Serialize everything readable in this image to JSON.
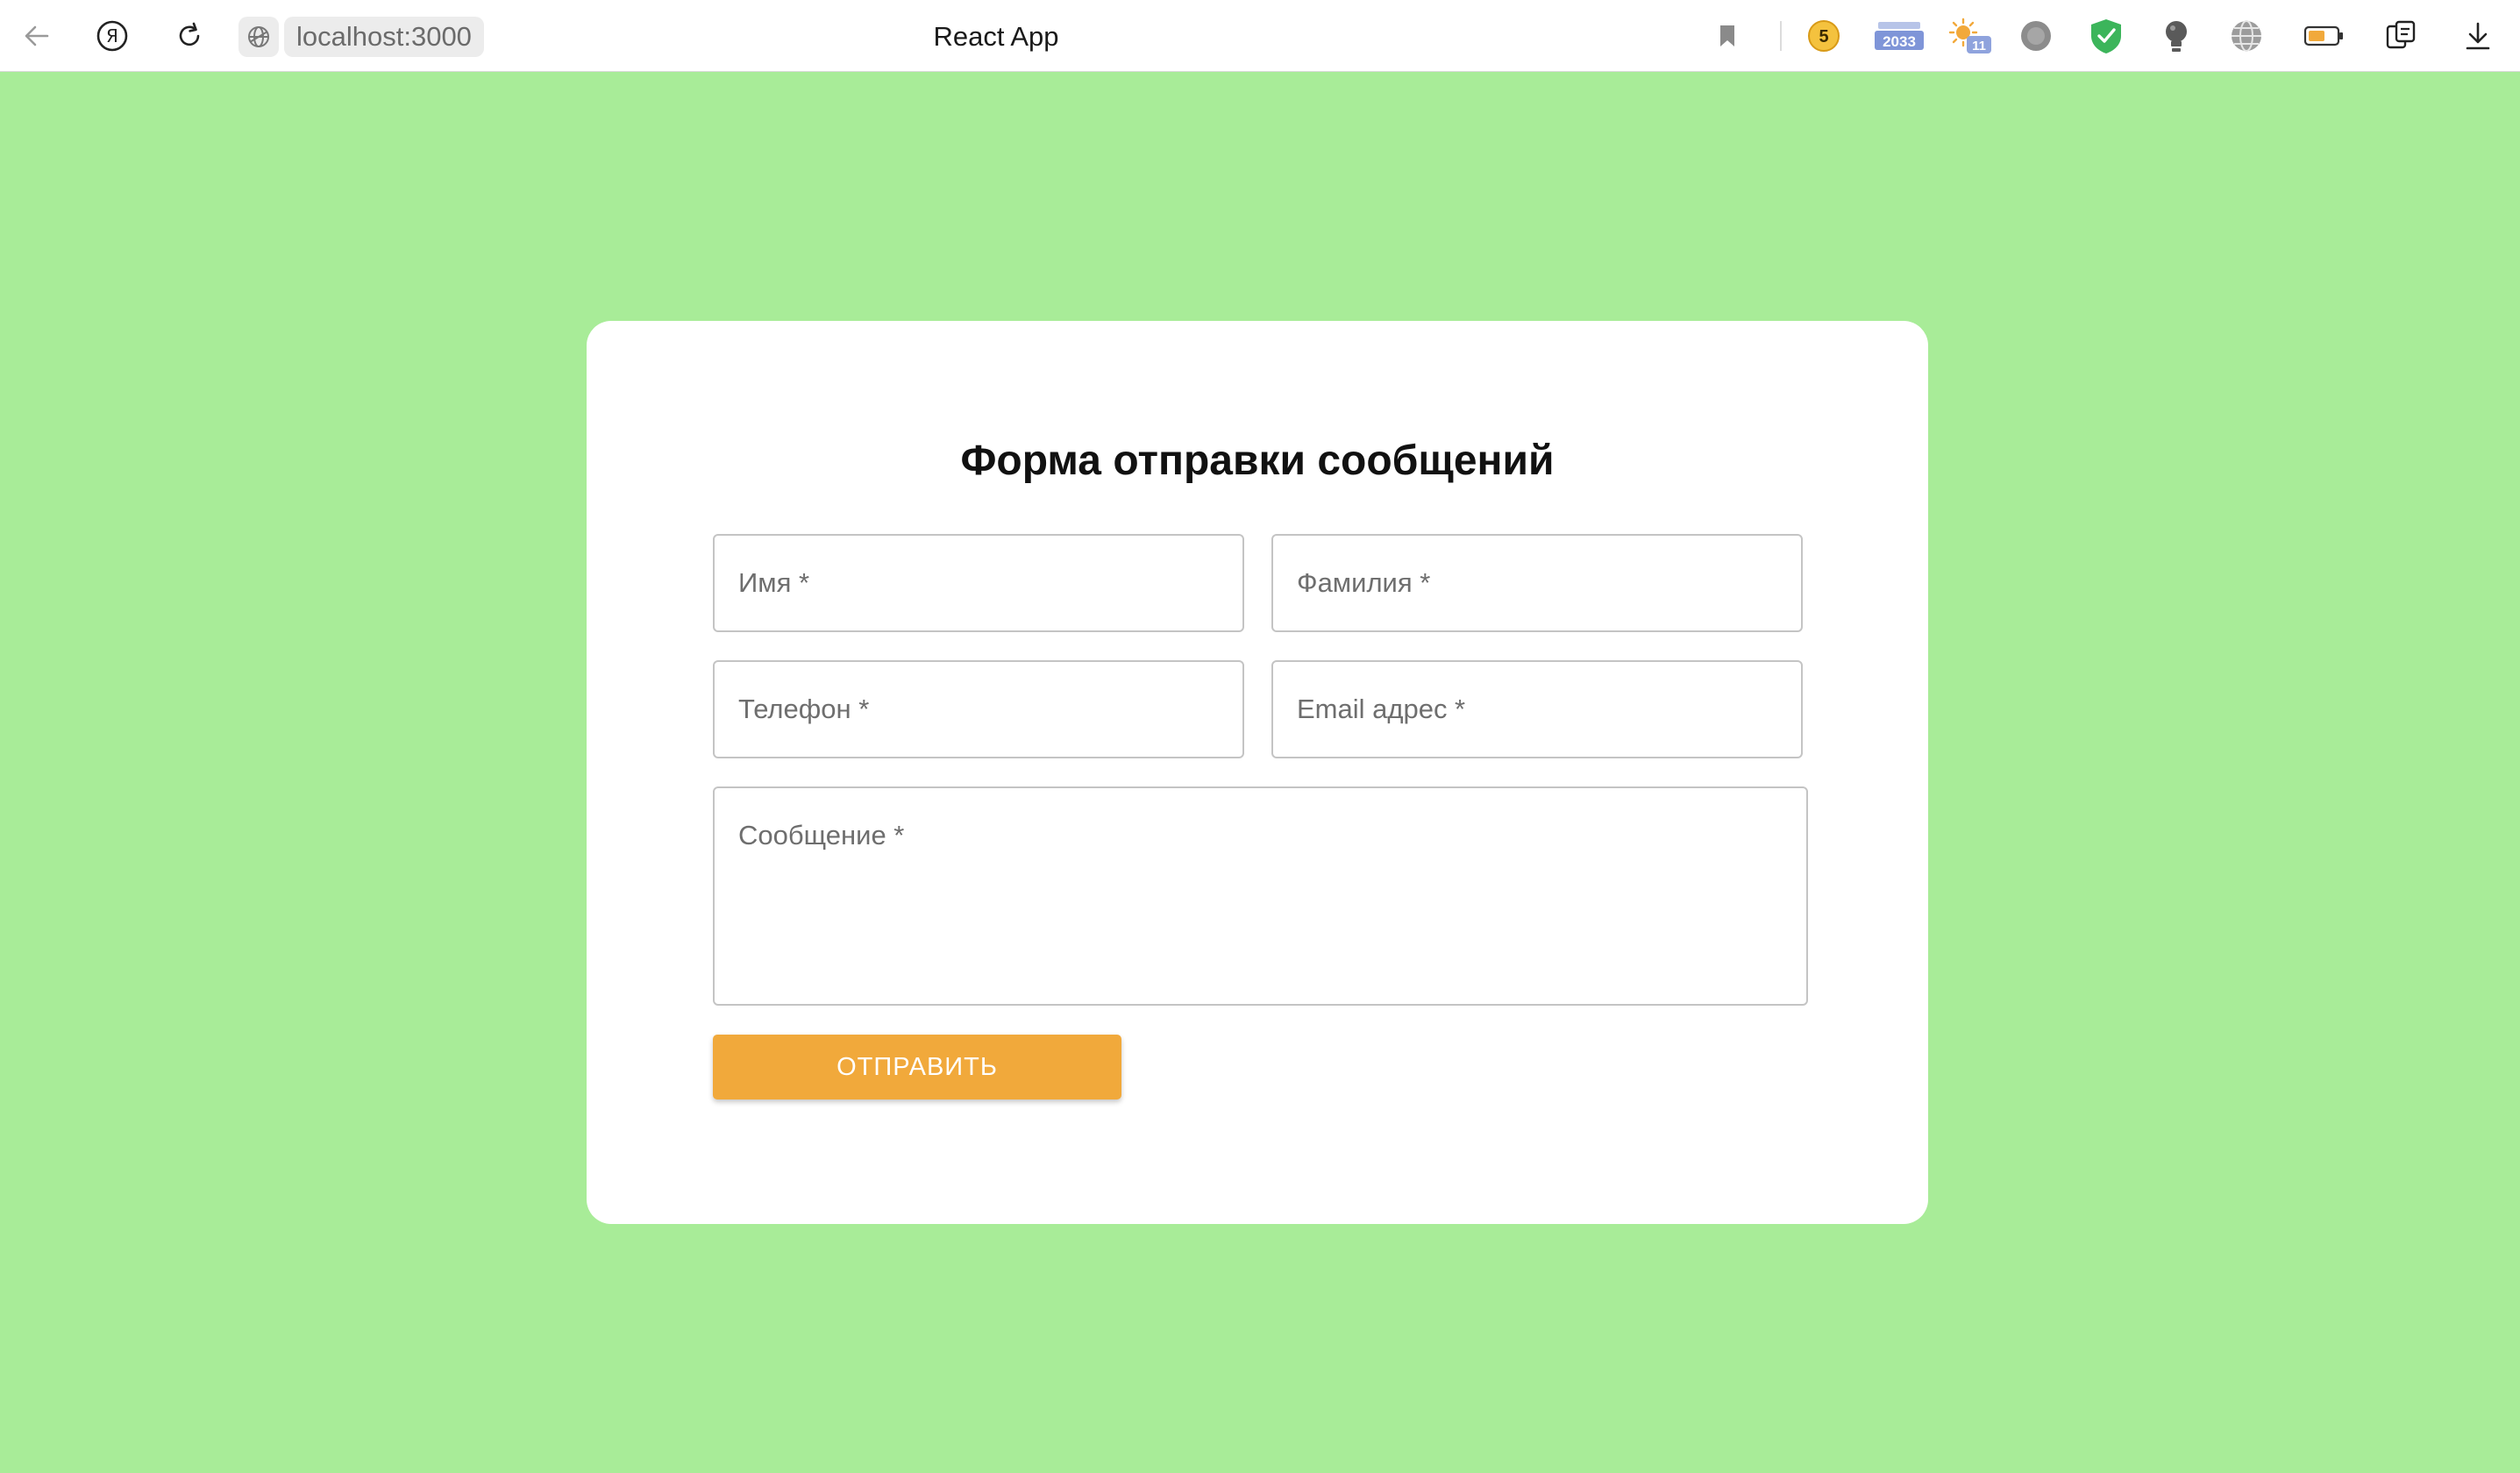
{
  "browser": {
    "tab_title": "React App",
    "address": "localhost:3000",
    "icons": [
      "back-icon",
      "yandex-icon",
      "reload-icon",
      "site-info-icon",
      "bookmark-icon",
      "divider",
      "extension-badge-icon",
      "extension-counter-icon",
      "extension-weather-icon",
      "extension-circle-icon",
      "extension-shield-icon",
      "extension-bulb-icon",
      "extension-globe-icon",
      "battery-icon",
      "extension-puzzle-icon",
      "download-icon"
    ],
    "extensions": {
      "badge_count": "5",
      "counter_value": "2033",
      "weather_value": "11"
    },
    "colors": {
      "toolbar_bg": "#ffffff",
      "address_bg": "#ececec",
      "shield_green": "#3cb55b"
    }
  },
  "page": {
    "background": "#a8ec98"
  },
  "form": {
    "title": "Форма отправки сообщений",
    "fields": {
      "first_name": "Имя *",
      "last_name": "Фамилия *",
      "phone": "Телефон *",
      "email": "Email адрес *",
      "message": "Сообщение *"
    },
    "submit_label": "ОТПРАВИТЬ",
    "colors": {
      "card_bg": "#ffffff",
      "submit_bg": "#f1a93b",
      "field_border": "#c4c4c4"
    }
  }
}
